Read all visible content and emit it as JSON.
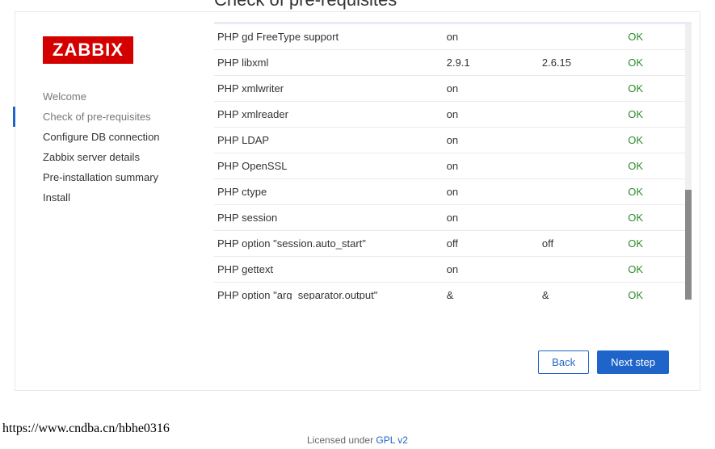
{
  "logo_text": "ZABBIX",
  "page_title": "Check of pre-requisites",
  "sidebar": {
    "items": [
      {
        "label": "Welcome"
      },
      {
        "label": "Check of pre-requisites"
      },
      {
        "label": "Configure DB connection"
      },
      {
        "label": "Zabbix server details"
      },
      {
        "label": "Pre-installation summary"
      },
      {
        "label": "Install"
      }
    ]
  },
  "rows": [
    {
      "name": "PHP gd FreeType support",
      "current": "on",
      "required": "",
      "status": "OK"
    },
    {
      "name": "PHP libxml",
      "current": "2.9.1",
      "required": "2.6.15",
      "status": "OK"
    },
    {
      "name": "PHP xmlwriter",
      "current": "on",
      "required": "",
      "status": "OK"
    },
    {
      "name": "PHP xmlreader",
      "current": "on",
      "required": "",
      "status": "OK"
    },
    {
      "name": "PHP LDAP",
      "current": "on",
      "required": "",
      "status": "OK"
    },
    {
      "name": "PHP OpenSSL",
      "current": "on",
      "required": "",
      "status": "OK"
    },
    {
      "name": "PHP ctype",
      "current": "on",
      "required": "",
      "status": "OK"
    },
    {
      "name": "PHP session",
      "current": "on",
      "required": "",
      "status": "OK"
    },
    {
      "name": "PHP option \"session.auto_start\"",
      "current": "off",
      "required": "off",
      "status": "OK"
    },
    {
      "name": "PHP gettext",
      "current": "on",
      "required": "",
      "status": "OK"
    },
    {
      "name": "PHP option \"arg_separator.output\"",
      "current": "&",
      "required": "&",
      "status": "OK"
    }
  ],
  "buttons": {
    "back": "Back",
    "next": "Next step"
  },
  "footer": {
    "url": "https://www.cndba.cn/hbhe0316",
    "license_prefix": "Licensed under ",
    "license_link": "GPL v2"
  }
}
